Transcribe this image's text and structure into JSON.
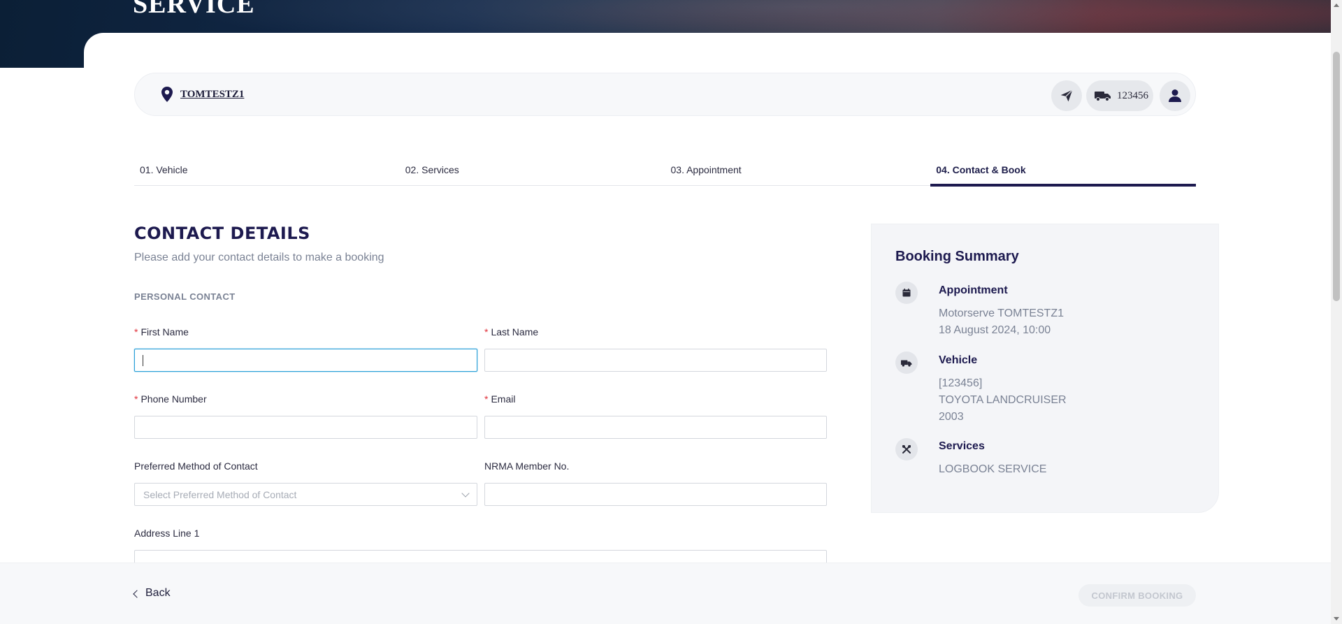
{
  "hero": {
    "title": "SERVICE"
  },
  "location_bar": {
    "location": "TOMTESTZ1",
    "vehicle_id": "123456"
  },
  "steps": [
    {
      "label": "01. Vehicle",
      "active": false
    },
    {
      "label": "02. Services",
      "active": false
    },
    {
      "label": "03. Appointment",
      "active": false
    },
    {
      "label": "04. Contact & Book",
      "active": true
    }
  ],
  "form": {
    "title": "CONTACT DETAILS",
    "subtitle": "Please add your contact details to make a booking",
    "section": "PERSONAL CONTACT",
    "required_mark": "*",
    "fields": {
      "first_name": {
        "label": "First Name",
        "value": ""
      },
      "last_name": {
        "label": "Last Name",
        "value": ""
      },
      "phone": {
        "label": "Phone Number",
        "value": ""
      },
      "email": {
        "label": "Email",
        "value": ""
      },
      "contact_method": {
        "label": "Preferred Method of Contact",
        "placeholder": "Select Preferred Method of Contact"
      },
      "nrma": {
        "label": "NRMA Member No.",
        "value": ""
      },
      "address1": {
        "label": "Address Line 1",
        "value": ""
      }
    }
  },
  "summary": {
    "title": "Booking Summary",
    "appointment": {
      "heading": "Appointment",
      "lines": [
        "Motorserve TOMTESTZ1",
        "18 August 2024, 10:00"
      ]
    },
    "vehicle": {
      "heading": "Vehicle",
      "lines": [
        "[123456]",
        "TOYOTA LANDCRUISER",
        "2003"
      ]
    },
    "services": {
      "heading": "Services",
      "lines": [
        "LOGBOOK SERVICE"
      ]
    }
  },
  "footer": {
    "back_label": "Back",
    "confirm_label": "CONFIRM BOOKING"
  },
  "colors": {
    "brand": "#1d1a4f",
    "required": "#e0303a",
    "focus": "#2aa0d8"
  }
}
